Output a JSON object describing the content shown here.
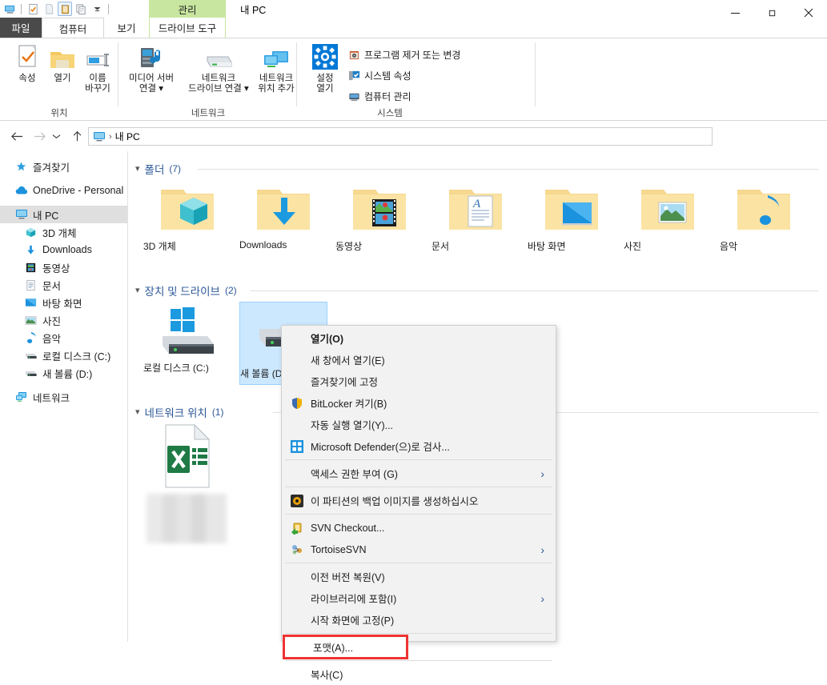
{
  "window": {
    "title": "내 PC",
    "manage_tab_label": "관리",
    "quick_access": [
      {
        "name": "pc-icon"
      },
      {
        "name": "properties-icon"
      },
      {
        "name": "new-folder-icon"
      },
      {
        "name": "clipboard-icon"
      },
      {
        "name": "copy-icon"
      },
      {
        "name": "customize-dropdown-icon"
      }
    ],
    "controls": {
      "minimize": "minimize",
      "maximize": "maximize",
      "close": "close"
    }
  },
  "tabs": [
    {
      "id": "file",
      "label": "파일"
    },
    {
      "id": "computer",
      "label": "컴퓨터"
    },
    {
      "id": "view",
      "label": "보기"
    },
    {
      "id": "drive-tools",
      "label": "드라이브 도구"
    }
  ],
  "ribbon": {
    "groups": [
      {
        "id": "location",
        "title": "위치",
        "buttons": [
          {
            "id": "properties",
            "label": "속성"
          },
          {
            "id": "open",
            "label": "열기"
          },
          {
            "id": "rename",
            "label": "이름\n바꾸기",
            "line1": "이름",
            "line2": "바꾸기"
          }
        ]
      },
      {
        "id": "network",
        "title": "네트워크",
        "buttons": [
          {
            "id": "media-server",
            "line1": "미디어 서버",
            "line2": "연결 ▾"
          },
          {
            "id": "map-network-drive",
            "line1": "네트워크",
            "line2": "드라이브 연결 ▾"
          },
          {
            "id": "add-network-location",
            "line1": "네트워크",
            "line2": "위치 추가"
          }
        ]
      },
      {
        "id": "system",
        "title": "시스템",
        "big": {
          "id": "open-settings",
          "line1": "설정",
          "line2": "열기"
        },
        "items": [
          {
            "id": "uninstall-change-program",
            "label": "프로그램 제거 또는 변경"
          },
          {
            "id": "system-properties",
            "label": "시스템 속성"
          },
          {
            "id": "computer-management",
            "label": "컴퓨터 관리"
          }
        ]
      }
    ]
  },
  "address": {
    "breadcrumb_root_icon": "pc-icon",
    "separator": "›",
    "path": "내 PC"
  },
  "sidebar": {
    "items": [
      {
        "id": "quick-access",
        "label": "즐겨찾기",
        "icon": "star-icon",
        "level": 0,
        "selected": false,
        "spacer_after": true
      },
      {
        "id": "onedrive",
        "label": "OneDrive - Personal",
        "icon": "cloud-icon",
        "level": 0,
        "selected": false,
        "spacer_after": true
      },
      {
        "id": "this-pc",
        "label": "내 PC",
        "icon": "pc-icon",
        "level": 0,
        "selected": true,
        "spacer_after": false
      },
      {
        "id": "3d-objects",
        "label": "3D 개체",
        "icon": "3d-object-icon",
        "level": 1,
        "selected": false,
        "spacer_after": false
      },
      {
        "id": "downloads",
        "label": "Downloads",
        "icon": "download-icon",
        "level": 1,
        "selected": false,
        "spacer_after": false
      },
      {
        "id": "videos",
        "label": "동영상",
        "icon": "video-icon",
        "level": 1,
        "selected": false,
        "spacer_after": false
      },
      {
        "id": "documents",
        "label": "문서",
        "icon": "document-icon",
        "level": 1,
        "selected": false,
        "spacer_after": false
      },
      {
        "id": "desktop",
        "label": "바탕 화면",
        "icon": "desktop-icon",
        "level": 1,
        "selected": false,
        "spacer_after": false
      },
      {
        "id": "pictures",
        "label": "사진",
        "icon": "picture-icon",
        "level": 1,
        "selected": false,
        "spacer_after": false
      },
      {
        "id": "music",
        "label": "음악",
        "icon": "music-icon",
        "level": 1,
        "selected": false,
        "spacer_after": false
      },
      {
        "id": "local-disk-c",
        "label": "로컬 디스크 (C:)",
        "icon": "drive-icon",
        "level": 1,
        "selected": false,
        "spacer_after": false
      },
      {
        "id": "new-volume-d",
        "label": "새 볼륨 (D:)",
        "icon": "drive-icon",
        "level": 1,
        "selected": false,
        "spacer_after": true
      },
      {
        "id": "network",
        "label": "네트워크",
        "icon": "network-icon",
        "level": 0,
        "selected": false,
        "spacer_after": false
      }
    ]
  },
  "content": {
    "groups": [
      {
        "id": "folders",
        "label": "폴더",
        "count": "(7)"
      },
      {
        "id": "devices-and-drives",
        "label": "장치 및 드라이브",
        "count": "(2)"
      },
      {
        "id": "network-locations",
        "label": "네트워크 위치",
        "count": "(1)"
      }
    ],
    "folders": [
      {
        "id": "3d-objects",
        "label": "3D 개체",
        "icon": "folder-3d-object-icon"
      },
      {
        "id": "downloads",
        "label": "Downloads",
        "icon": "folder-download-icon"
      },
      {
        "id": "videos",
        "label": "동영상",
        "icon": "folder-video-icon"
      },
      {
        "id": "documents",
        "label": "문서",
        "icon": "folder-document-icon"
      },
      {
        "id": "desktop",
        "label": "바탕 화면",
        "icon": "folder-desktop-icon"
      },
      {
        "id": "pictures",
        "label": "사진",
        "icon": "folder-picture-icon"
      },
      {
        "id": "music",
        "label": "음악",
        "icon": "folder-music-icon"
      }
    ],
    "drives": [
      {
        "id": "local-disk-c",
        "label": "로컬 디스크 (C:)",
        "icon": "drive-windows-icon",
        "selected": false
      },
      {
        "id": "new-volume-d",
        "label": "새 볼륨 (D:)",
        "icon": "drive-icon",
        "selected": true
      }
    ],
    "network_locations": [
      {
        "id": "excel-shortcut",
        "label": "",
        "icon": "excel-file-icon",
        "redacted": true
      }
    ]
  },
  "context_menu": {
    "items": [
      {
        "id": "open",
        "label": "열기(O)",
        "icon": null,
        "bold": true,
        "submenu": false
      },
      {
        "id": "open-new-window",
        "label": "새 창에서 열기(E)",
        "icon": null,
        "bold": false,
        "submenu": false
      },
      {
        "id": "pin-to-quick-access",
        "label": "즐겨찾기에 고정",
        "icon": null,
        "bold": false,
        "submenu": false
      },
      {
        "id": "turn-on-bitlocker",
        "label": "BitLocker 켜기(B)",
        "icon": "shield-icon",
        "bold": false,
        "submenu": false
      },
      {
        "id": "open-autoplay",
        "label": "자동 실행 열기(Y)...",
        "icon": null,
        "bold": false,
        "submenu": false
      },
      {
        "id": "scan-with-defender",
        "label": "Microsoft Defender(으)로 검사...",
        "icon": "defender-icon",
        "bold": false,
        "submenu": false
      },
      {
        "id": "separator-1",
        "separator": true
      },
      {
        "id": "give-access-to",
        "label": "액세스 권한 부여 (G)",
        "icon": null,
        "bold": false,
        "submenu": true
      },
      {
        "id": "separator-2",
        "separator": true
      },
      {
        "id": "create-backup-image",
        "label": "이 파티션의 백업 이미지를 생성하십시오",
        "icon": "backup-icon",
        "bold": false,
        "submenu": false
      },
      {
        "id": "separator-3",
        "separator": true
      },
      {
        "id": "svn-checkout",
        "label": "SVN Checkout...",
        "icon": "svn-checkout-icon",
        "bold": false,
        "submenu": false
      },
      {
        "id": "tortoisesvn",
        "label": "TortoiseSVN",
        "icon": "tortoisesvn-icon",
        "bold": false,
        "submenu": true
      },
      {
        "id": "separator-4",
        "separator": true
      },
      {
        "id": "restore-previous-versions",
        "label": "이전 버전 복원(V)",
        "icon": null,
        "bold": false,
        "submenu": false
      },
      {
        "id": "include-in-library",
        "label": "라이브러리에 포함(I)",
        "icon": null,
        "bold": false,
        "submenu": true
      },
      {
        "id": "pin-to-start",
        "label": "시작 화면에 고정(P)",
        "icon": null,
        "bold": false,
        "submenu": false
      },
      {
        "id": "separator-5",
        "separator": true
      },
      {
        "id": "format",
        "label": "포맷(A)...",
        "icon": null,
        "bold": false,
        "submenu": false,
        "highlighted": true
      },
      {
        "id": "separator-6",
        "separator": true
      },
      {
        "id": "copy",
        "label": "복사(C)",
        "icon": null,
        "bold": false,
        "submenu": false
      }
    ]
  },
  "colors": {
    "manage_tab_green": "#c8e6a0",
    "file_tab_dark": "#4a4a4a",
    "group_header_blue": "#2b5797",
    "selection_blue": "#cce8ff",
    "highlight_red": "#ef3333",
    "accent_blue": "#0078d7"
  }
}
